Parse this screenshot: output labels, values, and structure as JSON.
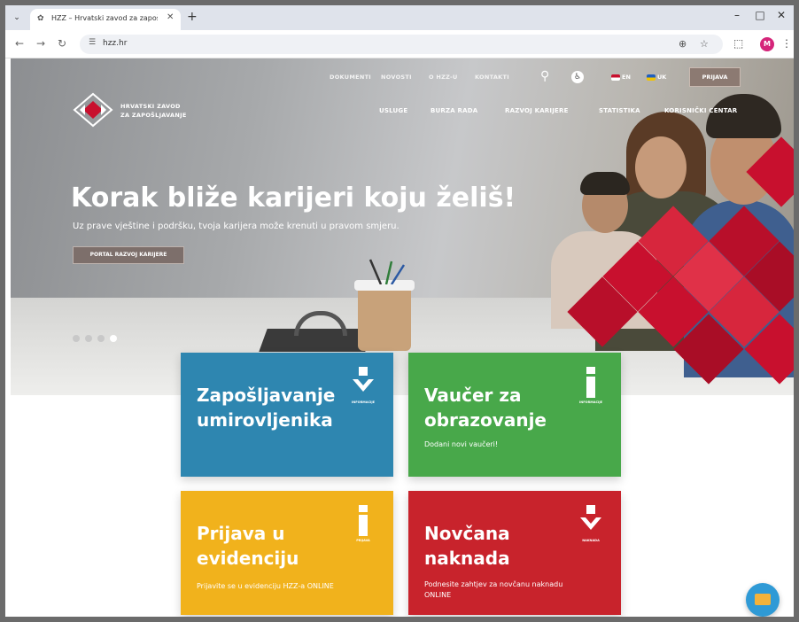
{
  "browser": {
    "tab_title": "HZZ – Hrvatski zavod za zapoš…",
    "url": "hzz.hr",
    "win_controls": [
      "–",
      "□",
      "✕"
    ],
    "nav": [
      "←",
      "→",
      "↻"
    ],
    "profile_initial": "M"
  },
  "site": {
    "logo_line1": "HRVATSKI ZAVOD",
    "logo_line2": "ZA ZAPOŠLJAVANJE",
    "topnav": [
      "DOKUMENTI",
      "NOVOSTI",
      "O HZZ-U",
      "KONTAKTI"
    ],
    "lang_en": "EN",
    "lang_uk": "UK",
    "login": "PRIJAVA",
    "mainnav": [
      "USLUGE",
      "BURZA RADA",
      "RAZVOJ KARIJERE",
      "STATISTIKA",
      "KORISNIČKI CENTAR"
    ],
    "brand_red": "#c8102e"
  },
  "hero": {
    "title": "Korak bliže karijeri koju želiš!",
    "subtitle": "Uz prave vještine i podršku, tvoja karijera može krenuti u pravom smjeru.",
    "button": "PORTAL RAZVOJ KARIJERE",
    "slides": 4,
    "active_slide": 4
  },
  "cards": [
    {
      "title_1": "Zapošljavanje",
      "title_2": "umirovljenika",
      "sub_1": "",
      "sub_2": "",
      "icon_label": "INFORMACIJE",
      "color": "#2e86b0"
    },
    {
      "title_1": "Vaučer za",
      "title_2": "obrazovanje",
      "sub_1": "Dodani novi vaučeri!",
      "sub_2": "",
      "icon_label": "INFORMACIJE",
      "color": "#48a84a"
    },
    {
      "title_1": "Prijava u",
      "title_2": "evidenciju",
      "sub_1": "Prijavite se u evidenciju HZZ-a ONLINE",
      "sub_2": "",
      "icon_label": "PRIJAVA",
      "color": "#f1b21c"
    },
    {
      "title_1": "Novčana",
      "title_2": "naknada",
      "sub_1": "Podnesite zahtjev za novčanu naknadu",
      "sub_2": "ONLINE",
      "icon_label": "NAKNADA",
      "color": "#c8232c"
    }
  ]
}
